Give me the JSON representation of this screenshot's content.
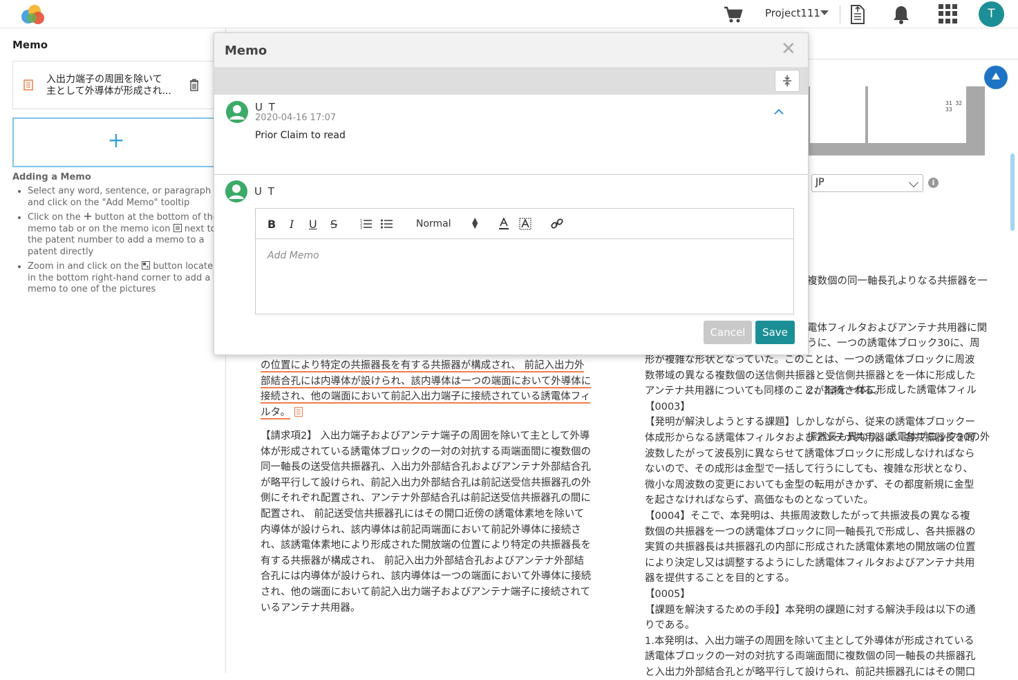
{
  "header": {
    "project_name": "Project111",
    "user_initial": "T"
  },
  "left_panel": {
    "title": "Memo",
    "memo_preview_line1": "入出力端子の周囲を除いて",
    "memo_preview_line2": "主として外導体が形成され...",
    "add_symbol": "+",
    "help_title": "Adding a Memo",
    "help_1": "Select any word, sentence, or paragraph and click on the \"Add Memo\" tooltip",
    "help_2a": "Click on the",
    "help_2b": "button at the bottom of the memo tab or on the memo icon",
    "help_2c": "next to the patent number to add a memo to a patent directly",
    "help_3a": "Zoom in and click on the",
    "help_3b": "button located in the bottom right-hand corner to add a memo to one of the pictures"
  },
  "figure": {
    "numbers": "31   32   33"
  },
  "language": {
    "selected": "JP"
  },
  "right_text_top": [
    "複数個の同一軸長孔よりなる共振器を一",
    "電体フィルタおよびアンテナ共用器に関"
  ],
  "right_text_mid": [
    "うに、一つの誘電体ブロック30に、周",
    "2、33を一体に形成した誘電体フィル",
    "振器長も異なり、誘電体ブロック30の外"
  ],
  "right_text_body": [
    "形が複雑な形状となっていた。このことは、一つの誘電体ブロックに周波",
    "数帯域の異なる複数個の送信側共振器と受信側共振器とを一体に形成した",
    "アンテナ共用器についても同様のことが指摘される。",
    "【0003】",
    "【発明が解決しようとする課題】しかしながら、従来の誘電体ブロックー",
    "体成形からなる誘電体フィルタおよびアンテナ共用器は、各共振器長を周",
    "波数したがって波長別に異ならせて誘電体ブロックに形成しなければなら",
    "ないので、その成形は金型で一括して行うにしても、複雑な形状となり、",
    "微小な周波数の変更においても金型の転用がきかず、その都度新規に金型",
    "を起さなければならず、高価なものとなっていた。",
    "【0004】そこで、本発明は、共振周波数したがって共振波長の異なる複",
    "数個の共振器を一つの誘電体ブロックに同一軸長孔で形成し、各共振器の",
    "実質の共振器長は共振器孔の内部に形成された誘電体素地の開放端の位置",
    "により決定し又は調整するようにした誘電体フィルタおよびアンテナ共用",
    "器を提供することを目的とする。",
    "【0005】",
    "【課題を解決するための手段】本発明の課題に対する解決手段は以下の通",
    "りである。",
    "1.本発明は、入出力端子の周囲を除いて主として外導体が形成されている",
    "誘電体ブロックの一対の対抗する両端面間に複数個の同一軸長の共振器孔",
    "と入出力外部結合孔とが略平行して設けられ、前記共振器孔にはその開口"
  ],
  "claim_highlight": [
    "の位置により特定の共振器長を有する共振器が構成され、 前記入出力外",
    "部結合孔には内導体が設けられ、該内導体は一つの端面において外導体に",
    "接続され、他の端面において前記入出力端子に接続されている誘電体フィ",
    "ルタ。"
  ],
  "claim2": [
    "【請求項2】 入出力端子およびアンテナ端子の周囲を除いて主として外導",
    "体が形成されている誘電体ブロックの一対の対抗する両端面間に複数個の",
    "同一軸長の送受信共振器孔、入出力外部結合孔およびアンテナ外部結合孔",
    "が略平行して設けられ、前記入出力外部結合孔は前記送受信共振器孔の外",
    "側にそれぞれ配置され、アンテナ外部結合孔は前記送受信共振器孔の間に",
    "配置され、 前記送受信共振器孔にはその開口近傍の誘電体素地を除いて",
    "内導体が設けられ、該内導体は前記両端面において前記外導体に接続さ",
    "れ、該誘電体素地により形成された開放端の位置により特定の共振器長を",
    "有する共振器が構成され、 前記入出力外部結合孔およびアンテナ外部結",
    "合孔には内導体が設けられ、該内導体は一つの端面において外導体に接続",
    "され、他の端面において前記入出力端子およびアンテナ端子に接続されて",
    "いるアンテナ共用器。"
  ],
  "modal": {
    "title": "Memo",
    "entry": {
      "user": "U T",
      "date": "2020-04-16 17:07",
      "text": "Prior Claim to read"
    },
    "compose_user": "U T",
    "toolbar": {
      "bold": "B",
      "italic": "I",
      "underline": "U",
      "strike": "S",
      "format": "Normal"
    },
    "placeholder": "Add Memo",
    "cancel": "Cancel",
    "save": "Save"
  },
  "colors": {
    "accent": "#1b8f95",
    "highlight": "#ef7d4a",
    "add_border": "#7fc4e8"
  }
}
